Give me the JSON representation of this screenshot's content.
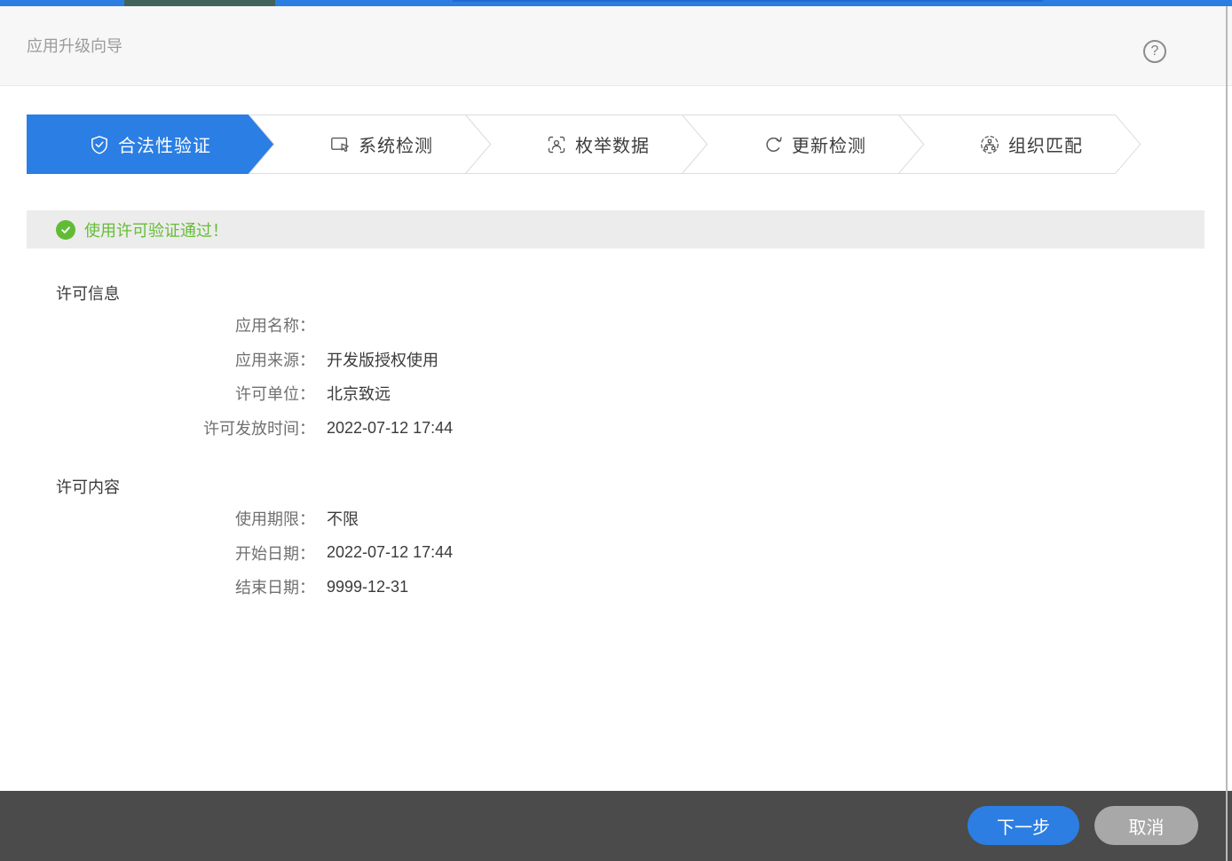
{
  "header": {
    "title": "应用升级向导",
    "help_glyph": "?"
  },
  "stepper": {
    "steps": [
      {
        "label": "合法性验证",
        "icon": "shield-check-icon",
        "active": true
      },
      {
        "label": "系统检测",
        "icon": "monitor-cursor-icon",
        "active": false
      },
      {
        "label": "枚举数据",
        "icon": "face-scan-icon",
        "active": false
      },
      {
        "label": "更新检测",
        "icon": "refresh-icon",
        "active": false
      },
      {
        "label": "组织匹配",
        "icon": "org-match-icon",
        "active": false
      }
    ]
  },
  "notice": {
    "text": "使用许可验证通过！"
  },
  "sections": [
    {
      "title": "许可信息",
      "rows": [
        {
          "label": "应用名称：",
          "value": ""
        },
        {
          "label": "应用来源：",
          "value": "开发版授权使用"
        },
        {
          "label": "许可单位：",
          "value": "北京致远"
        },
        {
          "label": "许可发放时间：",
          "value": "2022-07-12 17:44"
        }
      ]
    },
    {
      "title": "许可内容",
      "rows": [
        {
          "label": "使用期限：",
          "value": "不限"
        },
        {
          "label": "开始日期：",
          "value": "2022-07-12 17:44"
        },
        {
          "label": "结束日期：",
          "value": "9999-12-31"
        }
      ]
    }
  ],
  "footer": {
    "next_label": "下一步",
    "cancel_label": "取消"
  },
  "colors": {
    "accent_blue": "#2b7ee3",
    "success_green": "#65bd36",
    "footer_bg": "#4b4b4b",
    "cancel_gray": "#a8a8a8",
    "banner_bg": "#ececec"
  }
}
